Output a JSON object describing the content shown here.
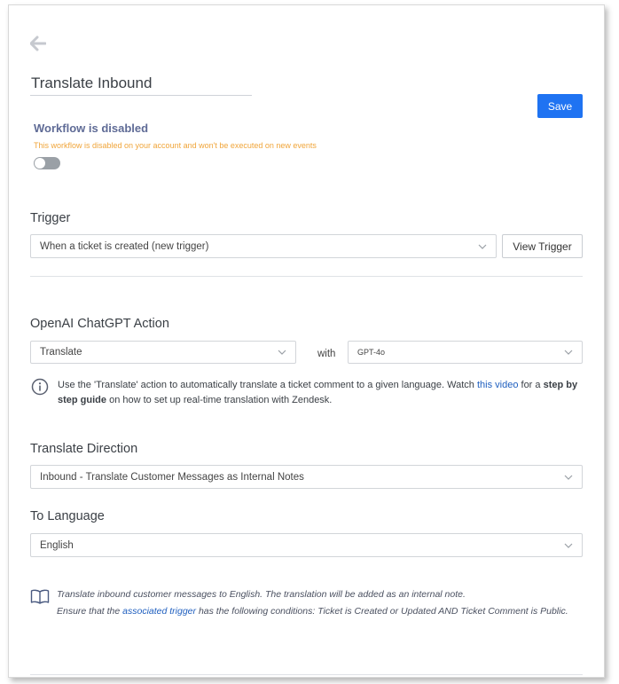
{
  "workflow": {
    "title_value": "Translate Inbound",
    "save_label": "Save",
    "status_title": "Workflow is disabled",
    "status_description": "This workflow is disabled on your account and won't be executed on new events",
    "enabled": false
  },
  "trigger": {
    "label": "Trigger",
    "selected": "When a ticket is created (new trigger)",
    "view_button": "View Trigger"
  },
  "action": {
    "label": "OpenAI ChatGPT Action",
    "selected": "Translate",
    "with_label": "with",
    "model": "GPT-4o",
    "info": {
      "text_before_link": "Use the 'Translate' action to automatically translate a ticket comment to a given language. Watch ",
      "link_text": "this video",
      "text_after_link": " for a ",
      "bold_text": "step by step guide",
      "text_end": " on how to set up real-time translation with Zendesk."
    }
  },
  "direction": {
    "label": "Translate Direction",
    "selected": "Inbound - Translate Customer Messages as Internal Notes"
  },
  "language": {
    "label": "To Language",
    "selected": "English"
  },
  "note": {
    "line1": "Translate inbound customer messages to English. The translation will be added as an internal note.",
    "line2_before": "Ensure that the ",
    "line2_link": "associated trigger",
    "line2_after": " has the following conditions: Ticket is Created or Updated AND Ticket Comment is Public."
  },
  "colors": {
    "accent": "#1f73f2",
    "warning": "#f0a53a",
    "status_title": "#5f6b96",
    "link": "#1f5fbf"
  },
  "icons": {
    "back": "arrow-left-icon",
    "chevron": "chevron-down-icon",
    "info": "info-circle-icon",
    "book": "open-book-icon"
  }
}
